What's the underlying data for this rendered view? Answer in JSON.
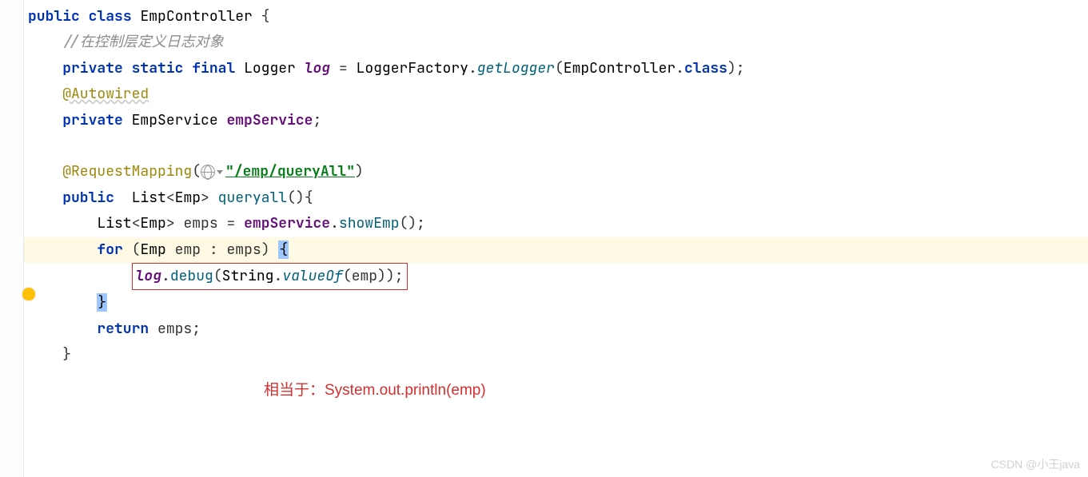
{
  "code": {
    "line1": {
      "kw_public": "public",
      "kw_class": "class",
      "classname": "EmpController",
      "brace": "{"
    },
    "line2": {
      "comment": "//在控制层定义日志对象"
    },
    "line3": {
      "kw_private": "private",
      "kw_static": "static",
      "kw_final": "final",
      "type": "Logger",
      "var": "log",
      "eq": "=",
      "factory": "LoggerFactory",
      "dot1": ".",
      "method": "getLogger",
      "lparen": "(",
      "arg_class": "EmpController",
      "dot2": ".",
      "kw_class2": "class",
      "rparen": ")",
      "semi": ";"
    },
    "line4": {
      "annotation": "@Autowired"
    },
    "line5": {
      "kw_private": "private",
      "type": "EmpService",
      "field": "empService",
      "semi": ";"
    },
    "line7": {
      "annotation": "@RequestMapping",
      "lparen": "(",
      "url": "\"/emp/queryAll\"",
      "rparen": ")"
    },
    "line8": {
      "kw_public": "public",
      "type1": "List",
      "lt": "<",
      "type2": "Emp",
      "gt": ">",
      "method": "queryall",
      "parens": "()",
      "brace": "{"
    },
    "line9": {
      "type1": "List",
      "lt": "<",
      "type2": "Emp",
      "gt": ">",
      "var": "emps",
      "eq": "=",
      "field": "empService",
      "dot": ".",
      "method": "showEmp",
      "parens": "()",
      "semi": ";"
    },
    "line10": {
      "kw_for": "for",
      "lparen": "(",
      "type": "Emp",
      "var": "emp",
      "colon": ":",
      "coll": "emps",
      "rparen": ")",
      "brace": "{"
    },
    "line11": {
      "var": "log",
      "dot1": ".",
      "method1": "debug",
      "lparen1": "(",
      "type": "String",
      "dot2": ".",
      "method2": "valueOf",
      "lparen2": "(",
      "arg": "emp",
      "rparen2": ")",
      "rparen1": ")",
      "semi": ";"
    },
    "line12": {
      "brace": "}"
    },
    "line13": {
      "kw_return": "return",
      "var": "emps",
      "semi": ";"
    },
    "line14": {
      "brace": "}"
    }
  },
  "annotation_text": "相当于：System.out.println(emp)",
  "watermark": "CSDN @小王java"
}
